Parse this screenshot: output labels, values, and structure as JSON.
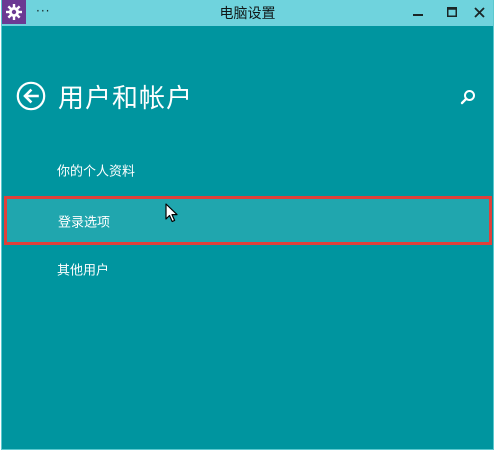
{
  "window": {
    "title": "电脑设置",
    "menu_glyph": "···"
  },
  "header": {
    "title": "用户和帐户"
  },
  "nav": {
    "items": [
      {
        "label": "你的个人资料"
      },
      {
        "label": "登录选项"
      },
      {
        "label": "其他用户"
      }
    ],
    "selected_index": 1
  },
  "icons": {
    "app": "gear-icon",
    "back": "back-arrow-circle-icon",
    "search": "search-icon",
    "minimize": "minimize-icon",
    "maximize": "maximize-icon",
    "close": "close-icon",
    "cursor": "mouse-pointer-icon"
  },
  "colors": {
    "background": "#00959f",
    "titlebar": "#6fd3dd",
    "app_icon_bg": "#6b3a93",
    "selected_item_bg": "#20a6ae",
    "highlight_border": "#e0403a",
    "text": "#ffffff"
  }
}
